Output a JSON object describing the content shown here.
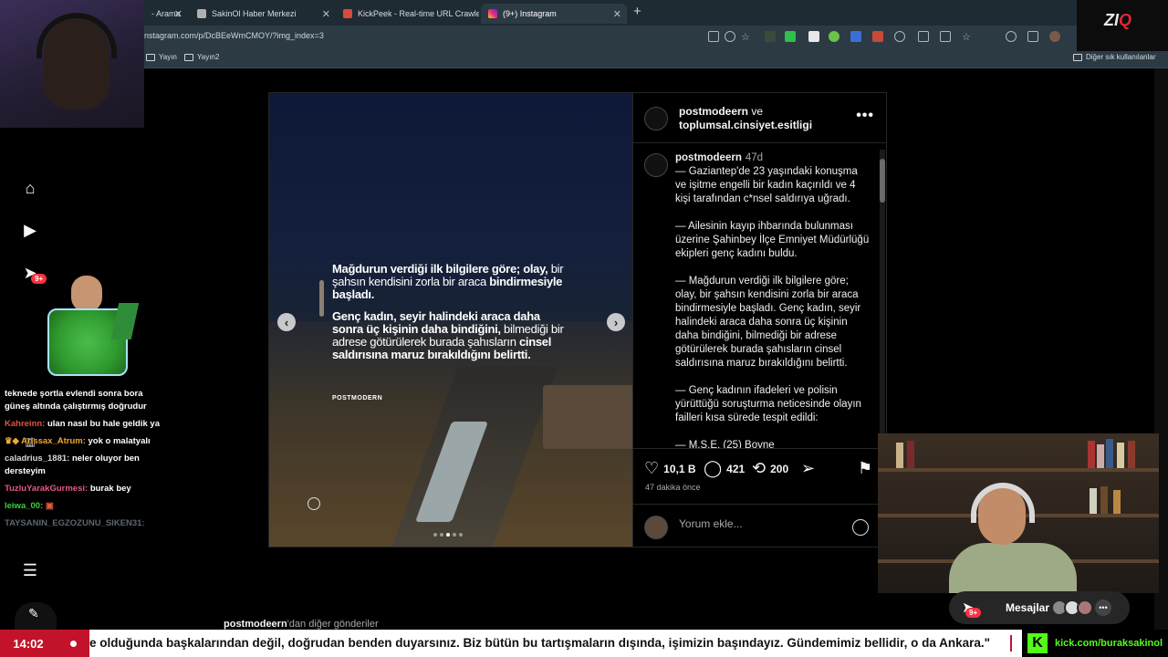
{
  "browser": {
    "tabs": [
      {
        "label": "- Arama",
        "active": false
      },
      {
        "label": "SakinOl Haber Merkezi",
        "active": false
      },
      {
        "label": "KickPeek - Real-time URL Crawler",
        "active": false
      },
      {
        "label": "(9+) Instagram",
        "active": true
      }
    ],
    "url": "nstagram.com/p/DcBEeWmCMOY/?img_index=3",
    "bookmarks": [
      {
        "label": "Yayın"
      },
      {
        "label": "Yayın2"
      }
    ],
    "other_bookmarks": "Diğer sık kullanılanlar"
  },
  "sidebar": {
    "notifications_badge": "9+"
  },
  "post": {
    "image_text": {
      "para1_bold": "Mağdurun verdiği ilk bilgilere göre;",
      "para1_bold2": "olay,",
      "para1_rest": "bir şahsın kendisini zorla bir araca",
      "para1_bold3": "bindirmesiyle başladı.",
      "para2_bold": "Genç kadın, seyir halindeki araca daha sonra üç kişinin daha bindiğini,",
      "para2_rest": "bilmediği bir adrese götürülerek burada şahısların",
      "para2_bold2": "cinsel saldırısına maruz bırakıldığını belirtti.",
      "brand": "POSTMODERN"
    },
    "header": {
      "user1": "postmodeern",
      "joiner": "ve",
      "user2": "toplumsal.cinsiyet.esitligi",
      "more": "•••"
    },
    "caption": {
      "user": "postmodeern",
      "time": "47d",
      "paragraphs": [
        "— Gaziantep'de 23 yaşındaki konuşma ve işitme engelli bir kadın kaçırıldı ve 4 kişi tarafından c*nsel saldırıya uğradı.",
        "— Ailesinin kayıp ihbarında bulunması üzerine Şahinbey İlçe Emniyet Müdürlüğü ekipleri genç kadını buldu.",
        "— Mağdurun verdiği ilk bilgilere göre; olay, bir şahsın kendisini zorla bir araca bindirmesiyle başladı. Genç kadın, seyir halindeki araca daha sonra üç kişinin daha bindiğini, bilmediği bir adrese götürülerek burada şahısların cinsel saldırısına maruz bırakıldığını belirtti.",
        "— Genç kadının ifadeleri ve polisin yürüttüğü soruşturma neticesinde olayın failleri kısa sürede tespit edildi:",
        "— M.S.E. (25) Boyne"
      ]
    },
    "stats": {
      "likes": "10,1 B",
      "comments": "421",
      "reposts": "200"
    },
    "posted_ago": "47 dakika önce",
    "comment_placeholder": "Yorum ekle...",
    "more_posts_user": "postmodeern",
    "more_posts_suffix": "'dan diğer gönderiler"
  },
  "messages": {
    "label": "Mesajlar",
    "badge": "9+"
  },
  "stream": {
    "logo_main": "ZI",
    "logo_accent": "Q",
    "chat": [
      {
        "user": "",
        "user_color": "#ffffff",
        "text": "teknede şortla evlendi sonra bora güneş altında çalıştırmış doğrudur"
      },
      {
        "user": "Kahreinn:",
        "user_color": "#e0533d",
        "text": "ulan nasıl bu hale geldik ya"
      },
      {
        "user": "Arissax_Atrum:",
        "user_color": "#f0a830",
        "text": "yok o malatyalı"
      },
      {
        "user": "caladrius_1881:",
        "user_color": "#d8d8d8",
        "text": "neler oluyor ben dersteyim"
      },
      {
        "user": "TuzluYarakGurmesi:",
        "user_color": "#e05a8e",
        "text": "burak bey"
      },
      {
        "user": "leiwa_00:",
        "user_color": "#3cd13c",
        "text": ""
      },
      {
        "user": "TAYSANIN_EGZOZUNU_SIKEN31:",
        "user_color": "#5c6670",
        "text": ""
      }
    ],
    "ticker_time": "14:02",
    "ticker_text": "e olduğunda başkalarından değil, doğrudan benden duyarsınız. Biz bütün bu tartışmaların dışında, işimizin başındayız. Gündemimiz bellidir, o da Ankara.\"",
    "kick_url": "kick.com/buraksakinol"
  },
  "colors": {
    "ticker_red": "#c3132b",
    "kick_green": "#53fc18",
    "ig_badge": "#ff3040"
  }
}
